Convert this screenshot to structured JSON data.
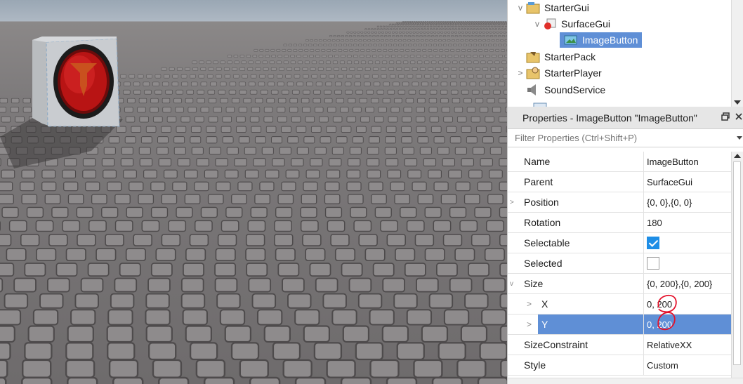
{
  "explorer": {
    "items": [
      {
        "label": "StarterGui",
        "chevron": "v",
        "icon": "folder-gui-icon"
      },
      {
        "label": "SurfaceGui",
        "chevron": "v",
        "icon": "surfacegui-icon"
      },
      {
        "label": "ImageButton",
        "chevron": "",
        "icon": "imagebutton-icon",
        "selected": true
      },
      {
        "label": "StarterPack",
        "chevron": "",
        "icon": "starterpack-icon"
      },
      {
        "label": "StarterPlayer",
        "chevron": ">",
        "icon": "starterplayer-icon"
      },
      {
        "label": "SoundService",
        "chevron": "",
        "icon": "soundservice-icon"
      }
    ]
  },
  "properties": {
    "title": "Properties - ImageButton \"ImageButton\"",
    "filter_placeholder": "Filter Properties (Ctrl+Shift+P)",
    "rows": [
      {
        "name": "Name",
        "value": "ImageButton"
      },
      {
        "name": "Parent",
        "value": "SurfaceGui"
      },
      {
        "name": "Position",
        "value": "{0, 0},{0, 0}",
        "expandable": ">"
      },
      {
        "name": "Rotation",
        "value": "180"
      },
      {
        "name": "Selectable",
        "checked": true
      },
      {
        "name": "Selected",
        "checked": false
      },
      {
        "name": "Size",
        "value": "{0, 200},{0, 200}",
        "expandable": "v"
      },
      {
        "name": "X",
        "value": "0, 200",
        "sub": true
      },
      {
        "name": "Y",
        "value": "0, 200",
        "sub": true,
        "selected": true
      },
      {
        "name": "SizeConstraint",
        "value": "RelativeXX"
      },
      {
        "name": "Style",
        "value": "Custom"
      }
    ]
  },
  "colors": {
    "selection": "#5f8fd6",
    "annotation": "#e4102a",
    "checkbox_on": "#1e8ee6"
  }
}
